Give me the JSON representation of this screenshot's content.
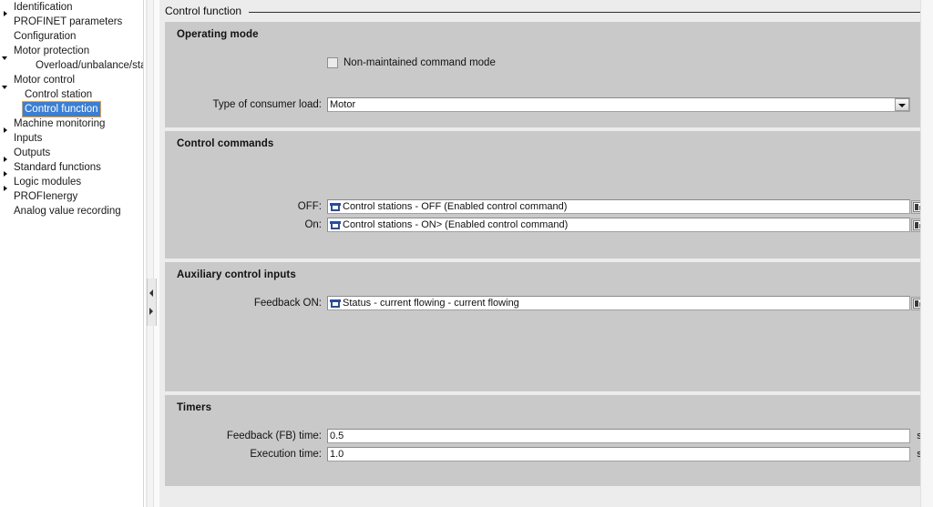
{
  "nav": {
    "items": [
      {
        "label": "Identification",
        "arrow": "collapsed",
        "indent": 0,
        "selected": false
      },
      {
        "label": "PROFINET parameters",
        "arrow": "none",
        "indent": 0,
        "selected": false
      },
      {
        "label": "Configuration",
        "arrow": "none",
        "indent": 0,
        "selected": false
      },
      {
        "label": "Motor protection",
        "arrow": "expanded",
        "indent": 0,
        "selected": false
      },
      {
        "label": "Overload/unbalance/stall...",
        "arrow": "none",
        "indent": 2,
        "selected": false
      },
      {
        "label": "Motor control",
        "arrow": "expanded",
        "indent": 0,
        "selected": false
      },
      {
        "label": "Control station",
        "arrow": "none",
        "indent": 1,
        "selected": false
      },
      {
        "label": "Control function",
        "arrow": "none",
        "indent": 1,
        "selected": true
      },
      {
        "label": "Machine monitoring",
        "arrow": "collapsed",
        "indent": 0,
        "selected": false
      },
      {
        "label": "Inputs",
        "arrow": "none",
        "indent": 0,
        "selected": false
      },
      {
        "label": "Outputs",
        "arrow": "collapsed",
        "indent": 0,
        "selected": false
      },
      {
        "label": "Standard functions",
        "arrow": "collapsed",
        "indent": 0,
        "selected": false
      },
      {
        "label": "Logic modules",
        "arrow": "collapsed",
        "indent": 0,
        "selected": false
      },
      {
        "label": "PROFIenergy",
        "arrow": "none",
        "indent": 0,
        "selected": false
      },
      {
        "label": "Analog value recording",
        "arrow": "none",
        "indent": 0,
        "selected": false
      }
    ]
  },
  "page": {
    "title": "Control function"
  },
  "operating_mode": {
    "title": "Operating mode",
    "checkbox_label": "Non-maintained command mode",
    "checkbox_checked": false,
    "consumer_load_label": "Type of consumer load:",
    "consumer_load_value": "Motor"
  },
  "control_commands": {
    "title": "Control commands",
    "off_label": "OFF:",
    "off_value": "Control stations - OFF (Enabled control command)",
    "on_label": "On:",
    "on_value": "Control stations - ON> (Enabled control command)"
  },
  "auxiliary_inputs": {
    "title": "Auxiliary control inputs",
    "feedback_on_label": "Feedback ON:",
    "feedback_on_value": "Status - current flowing - current flowing"
  },
  "timers": {
    "title": "Timers",
    "fb_time_label": "Feedback (FB) time:",
    "fb_time_value": "0.5",
    "fb_time_unit": "s",
    "execution_time_label": "Execution time:",
    "execution_time_value": "1.0",
    "execution_time_unit": "s"
  },
  "colors": {
    "panel": "#c9c9c9",
    "window": "#ececec",
    "selection": "#3a7fd5",
    "selection_outline": "#f0a030",
    "tag_icon": "#2b4b9b"
  }
}
